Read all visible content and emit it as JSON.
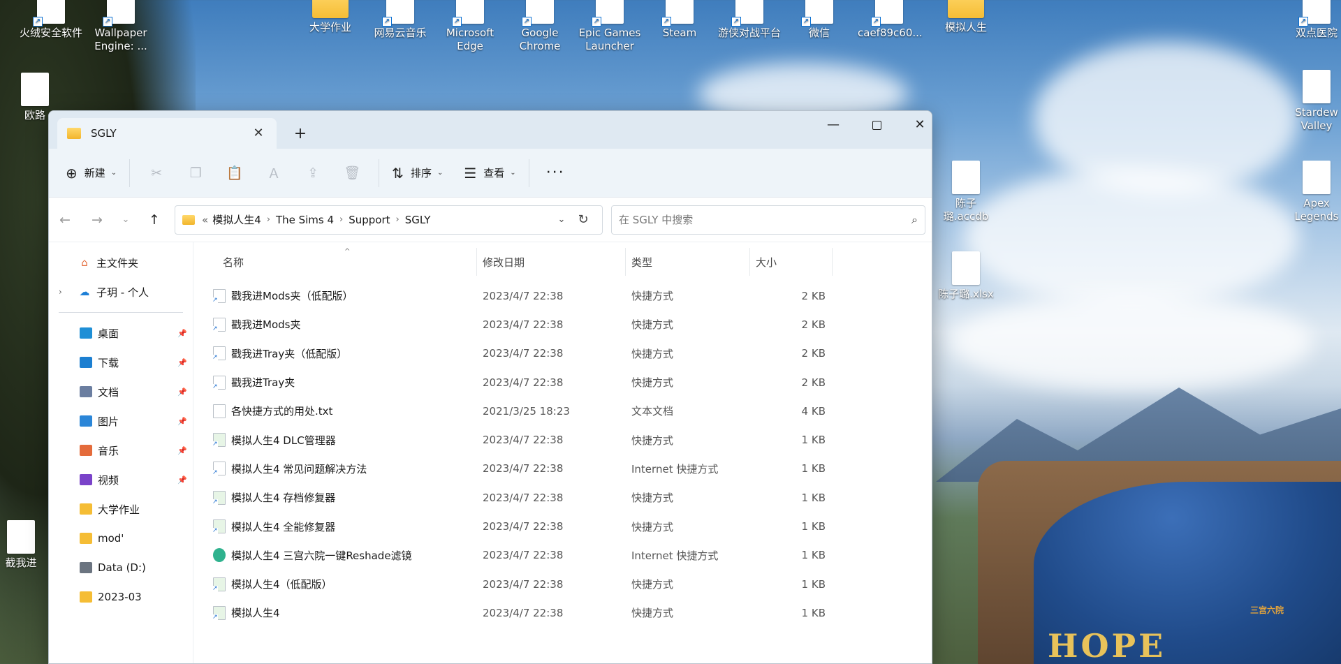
{
  "desktop": {
    "icons_top": [
      {
        "label": "火绒安全软件"
      },
      {
        "label": "Wallpaper Engine: ..."
      },
      {
        "label": "大学作业"
      },
      {
        "label": "网易云音乐"
      },
      {
        "label": "Microsoft Edge"
      },
      {
        "label": "Google Chrome"
      },
      {
        "label": "Epic Games Launcher"
      },
      {
        "label": "Steam"
      },
      {
        "label": "游侠对战平台"
      },
      {
        "label": "微信"
      },
      {
        "label": "caef89c60..."
      },
      {
        "label": "模拟人生"
      },
      {
        "label": "双点医院"
      }
    ],
    "icons_right": [
      {
        "label": "Stardew Valley"
      },
      {
        "label": "Apex Legends"
      },
      {
        "label": "陈子璐.accdb"
      },
      {
        "label": "陈子璐.xlsx"
      }
    ],
    "icons_left_partial": [
      {
        "label": "欧路"
      },
      {
        "label": "截我进"
      }
    ],
    "wallpaper_sign_text": "HOPE",
    "wallpaper_watermark": "三宫六院"
  },
  "window": {
    "tab_title": "SGLY",
    "new_tab": "+",
    "controls": {
      "minimize": "—",
      "close": "✕"
    }
  },
  "toolbar": {
    "new_label": "新建",
    "sort_label": "排序",
    "view_label": "查看",
    "more_label": "···"
  },
  "address": {
    "overflow": "«",
    "segments": [
      "模拟人生4",
      "The Sims 4",
      "Support",
      "SGLY"
    ],
    "search_placeholder": "在 SGLY 中搜索"
  },
  "sidebar": {
    "top": [
      {
        "label": "主文件夹"
      },
      {
        "label": "子玥 - 个人"
      }
    ],
    "quick": [
      {
        "label": "桌面",
        "color": "#1f8fd6",
        "pinned": true
      },
      {
        "label": "下载",
        "color": "#1c7fd1",
        "pinned": true
      },
      {
        "label": "文档",
        "color": "#6b7ea0",
        "pinned": true
      },
      {
        "label": "图片",
        "color": "#2b86d8",
        "pinned": true
      },
      {
        "label": "音乐",
        "color": "#e46b3b",
        "pinned": true
      },
      {
        "label": "视频",
        "color": "#7a43c9",
        "pinned": true
      },
      {
        "label": "大学作业",
        "color": "#f5bd35",
        "pinned": false
      },
      {
        "label": "mod'",
        "color": "#f5bd35",
        "pinned": false
      },
      {
        "label": "Data (D:)",
        "color": "#6b7480",
        "pinned": false
      },
      {
        "label": "2023-03",
        "color": "#f5bd35",
        "pinned": false
      }
    ]
  },
  "columns": {
    "name": "名称",
    "modified": "修改日期",
    "type": "类型",
    "size": "大小"
  },
  "files": [
    {
      "name": "戳我进Mods夹（低配版）",
      "modified": "2023/4/7 22:38",
      "type": "快捷方式",
      "size": "2 KB",
      "icon": "shortcut-icon"
    },
    {
      "name": "戳我进Mods夹",
      "modified": "2023/4/7 22:38",
      "type": "快捷方式",
      "size": "2 KB",
      "icon": "shortcut-icon"
    },
    {
      "name": "戳我进Tray夹（低配版）",
      "modified": "2023/4/7 22:38",
      "type": "快捷方式",
      "size": "2 KB",
      "icon": "shortcut-icon"
    },
    {
      "name": "戳我进Tray夹",
      "modified": "2023/4/7 22:38",
      "type": "快捷方式",
      "size": "2 KB",
      "icon": "shortcut-icon"
    },
    {
      "name": "各快捷方式的用处.txt",
      "modified": "2021/3/25 18:23",
      "type": "文本文档",
      "size": "4 KB",
      "icon": "text-file-icon"
    },
    {
      "name": "模拟人生4 DLC管理器",
      "modified": "2023/4/7 22:38",
      "type": "快捷方式",
      "size": "1 KB",
      "icon": "sims-shortcut-icon"
    },
    {
      "name": "模拟人生4 常见问题解决方法",
      "modified": "2023/4/7 22:38",
      "type": "Internet 快捷方式",
      "size": "1 KB",
      "icon": "internet-shortcut-icon"
    },
    {
      "name": "模拟人生4 存档修复器",
      "modified": "2023/4/7 22:38",
      "type": "快捷方式",
      "size": "1 KB",
      "icon": "sims-shortcut-icon"
    },
    {
      "name": "模拟人生4 全能修复器",
      "modified": "2023/4/7 22:38",
      "type": "快捷方式",
      "size": "1 KB",
      "icon": "sims-shortcut-icon"
    },
    {
      "name": "模拟人生4 三宫六院一键Reshade滤镜",
      "modified": "2023/4/7 22:38",
      "type": "Internet 快捷方式",
      "size": "1 KB",
      "icon": "edge-icon"
    },
    {
      "name": "模拟人生4（低配版）",
      "modified": "2023/4/7 22:38",
      "type": "快捷方式",
      "size": "1 KB",
      "icon": "sims-shortcut-icon"
    },
    {
      "name": "模拟人生4",
      "modified": "2023/4/7 22:38",
      "type": "快捷方式",
      "size": "1 KB",
      "icon": "sims-shortcut-icon"
    }
  ]
}
